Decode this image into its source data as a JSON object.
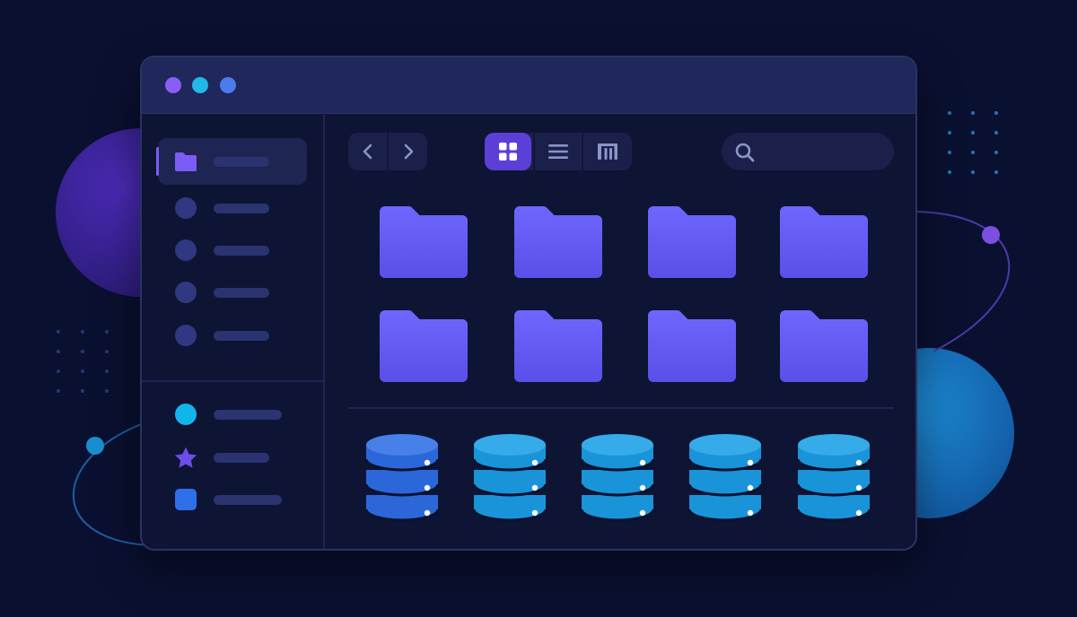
{
  "window": {
    "controls": [
      {
        "name": "close",
        "color": "#8b5cf6"
      },
      {
        "name": "minimize",
        "color": "#22b8e8"
      },
      {
        "name": "maximize",
        "color": "#4a7cf0"
      }
    ]
  },
  "sidebar": {
    "primary_items": [
      {
        "icon": "folder-icon",
        "active": true
      },
      {
        "icon": "circle-icon",
        "active": false
      },
      {
        "icon": "circle-icon",
        "active": false
      },
      {
        "icon": "circle-icon",
        "active": false
      },
      {
        "icon": "circle-icon",
        "active": false
      }
    ],
    "secondary_items": [
      {
        "icon": "cyan-circle-icon",
        "color": "#12b5ea"
      },
      {
        "icon": "star-icon",
        "color": "#6a4ee8"
      },
      {
        "icon": "square-icon",
        "color": "#2f6fe8"
      }
    ]
  },
  "toolbar": {
    "nav": {
      "back_icon": "chevron-left-icon",
      "forward_icon": "chevron-right-icon"
    },
    "view_modes": [
      {
        "icon": "grid-view-icon",
        "selected": true
      },
      {
        "icon": "list-view-icon",
        "selected": false
      },
      {
        "icon": "columns-view-icon",
        "selected": false
      }
    ]
  },
  "search": {
    "icon": "search-icon",
    "placeholder": "",
    "value": ""
  },
  "folders": {
    "count": 8,
    "icon": "folder-icon",
    "color": "#6a5cf5"
  },
  "databases": {
    "count": 5,
    "icon": "database-icon",
    "colors": [
      "#2f6fe8",
      "#1aa0e6",
      "#1aa0e6",
      "#1aa0e6",
      "#1aa0e6"
    ]
  },
  "colors": {
    "background": "#0a1030",
    "window": "#0e1434",
    "titlebar": "#20275a",
    "accent": "#7b5cf5",
    "selected_view": "#5b3fd6"
  }
}
